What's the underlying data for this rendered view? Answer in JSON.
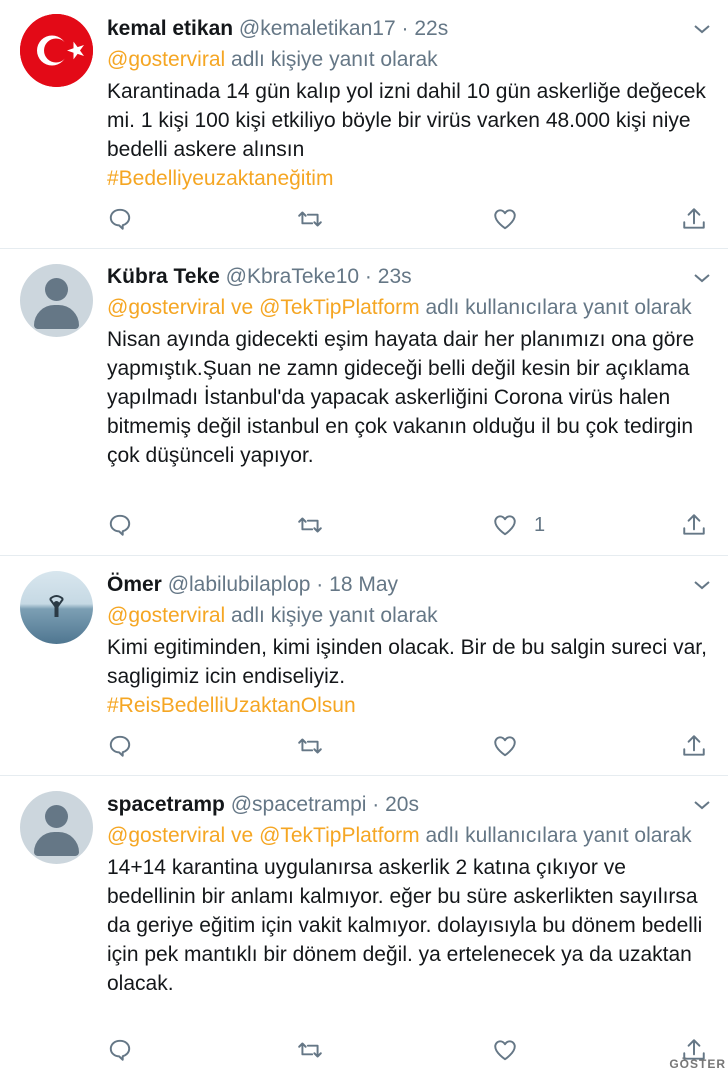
{
  "reply_prefix_single": "adlı kişiye yanıt olarak",
  "reply_prefix_multi": "adlı kullanıcılara yanıt olarak",
  "watermark": "GÖSTER",
  "colors": {
    "link": "#f5a623",
    "muted": "#657786",
    "text": "#14171a",
    "divider": "#e6ecf0"
  },
  "tweets": [
    {
      "name": "kemal etikan",
      "handle": "@kemaletikan17",
      "time": "22s",
      "avatar": "turkish-flag",
      "reply_mentions": [
        "@gosterviral"
      ],
      "reply_suffix": "adlı kişiye yanıt olarak",
      "text": "Karantinada 14 gün kalıp yol izni dahil 10 gün askerliğe değecek mi. 1 kişi 100 kişi etkiliyo böyle bir virüs varken 48.000 kişi niye bedelli askere alınsın",
      "hashtag": "#Bedelliyeuzaktaneğitim",
      "likes": ""
    },
    {
      "name": "Kübra Teke",
      "handle": "@KbraTeke10",
      "time": "23s",
      "avatar": "default",
      "reply_mentions": [
        "@gosterviral",
        "@TekTipPlatform"
      ],
      "reply_suffix": "adlı kullanıcılara yanıt olarak",
      "text": "Nisan ayında gidecekti eşim hayata dair her planımızı ona göre yapmıştık.Şuan ne zamn gideceği belli değil kesin bir açıklama yapılmadı İstanbul'da yapacak askerliğini Corona virüs halen bitmemiş değil istanbul en çok vakanın olduğu il bu çok tedirgin çok düşünceli yapıyor.",
      "hashtag": "",
      "likes": "1"
    },
    {
      "name": "Ömer",
      "handle": "@labilubilaplop",
      "time": "18 May",
      "avatar": "sea-photo",
      "reply_mentions": [
        "@gosterviral"
      ],
      "reply_suffix": "adlı kişiye yanıt olarak",
      "text": "Kimi egitiminden, kimi işinden olacak. Bir de bu salgin sureci var, sagligimiz icin endiseliyiz.",
      "hashtag": "#ReisBedelliUzaktanOlsun",
      "likes": ""
    },
    {
      "name": "spacetramp",
      "handle": "@spacetrampi",
      "time": "20s",
      "avatar": "default",
      "reply_mentions": [
        "@gosterviral",
        "@TekTipPlatform"
      ],
      "reply_suffix": "adlı kullanıcılara yanıt olarak",
      "text": "14+14 karantina uygulanırsa askerlik 2 katına çıkıyor ve bedellinin bir anlamı kalmıyor. eğer bu süre askerlikten sayılırsa da geriye eğitim için vakit kalmıyor. dolayısıyla bu dönem bedelli için pek mantıklı bir dönem değil. ya ertelenecek ya da uzaktan olacak.",
      "hashtag": "",
      "likes": ""
    }
  ]
}
